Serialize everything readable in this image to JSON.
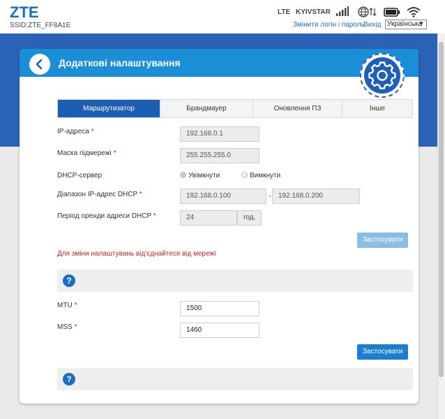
{
  "header": {
    "brand": "ZTE",
    "ssid": "SSID:ZTE_FF8A1E",
    "network_type": "LTE",
    "carrier": "KYIVSTAR",
    "change_login_link": "Змінити логін і пароль",
    "logout_link": "Вихід",
    "language": "Українська"
  },
  "page": {
    "title": "Додаткові налаштування"
  },
  "tabs": [
    {
      "label": "Маршрутизатор",
      "active": true
    },
    {
      "label": "Брандмауер",
      "active": false
    },
    {
      "label": "Оновлення ПЗ",
      "active": false
    },
    {
      "label": "Інше",
      "active": false
    }
  ],
  "router_form": {
    "ip_label": "IP-адреса",
    "ip_value": "192.168.0.1",
    "mask_label": "Маска підмережі",
    "mask_value": "255.255.255.0",
    "dhcp_label": "DHCP-сервер",
    "dhcp_on_label": "Увімкнути",
    "dhcp_off_label": "Вимкнути",
    "range_label": "Діапазон IP-адрес DHCP",
    "range_start": "192.168.0.100",
    "range_sep": "-",
    "range_end": "192.168.0.200",
    "lease_label": "Період оренди адреси DHCP",
    "lease_value": "24",
    "lease_unit": "год.",
    "required_mark": "*",
    "apply_label": "Застосувати",
    "warning": "Для зміни налаштувань від'єднайтеся від мережі"
  },
  "mtu_form": {
    "mtu_label": "MTU",
    "mtu_value": "1500",
    "mss_label": "MSS",
    "mss_value": "1460",
    "required_mark": "*",
    "apply_label": "Застосувати"
  },
  "help_glyph": "?",
  "colors": {
    "brand_blue": "#1a6fc0",
    "page_bg": "#2a62b8",
    "header_bar": "#1a8fd8",
    "tab_active": "#1a5fb4",
    "warning_red": "#d02020"
  }
}
